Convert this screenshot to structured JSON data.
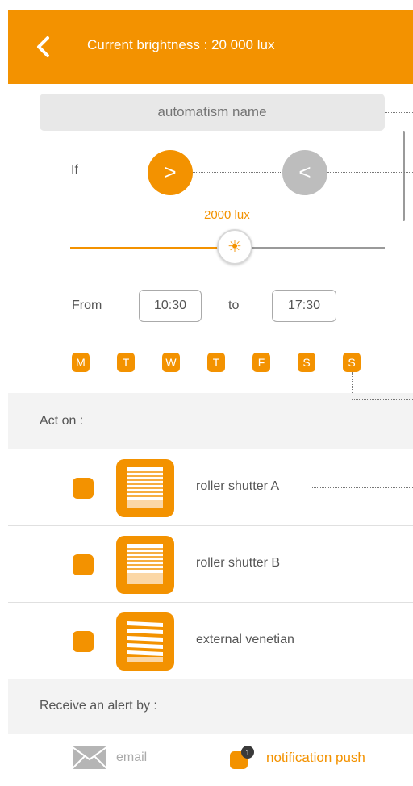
{
  "header": {
    "title": "Current brightness : 20 000 lux"
  },
  "automatism": {
    "name_placeholder": "automatism name"
  },
  "condition": {
    "if_label": "If",
    "greater_label": ">",
    "less_label": "<",
    "threshold_label": "2000 lux",
    "threshold_fraction": 0.5
  },
  "schedule": {
    "from_label": "From",
    "from_value": "10:30",
    "to_label": "to",
    "to_value": "17:30"
  },
  "days": [
    "M",
    "T",
    "W",
    "T",
    "F",
    "S",
    "S"
  ],
  "act_on": {
    "label": "Act on :",
    "items": [
      {
        "label": "roller shutter A",
        "icon": "roller-shutter-icon"
      },
      {
        "label": "roller shutter B",
        "icon": "roller-shutter-icon"
      },
      {
        "label": "external venetian",
        "icon": "venetian-blind-icon"
      }
    ]
  },
  "alert": {
    "label": "Receive an alert by :",
    "email_label": "email",
    "push_label": "notification push",
    "push_badge": "1"
  },
  "colors": {
    "accent": "#f39200",
    "inactive": "#bdbdbd"
  }
}
